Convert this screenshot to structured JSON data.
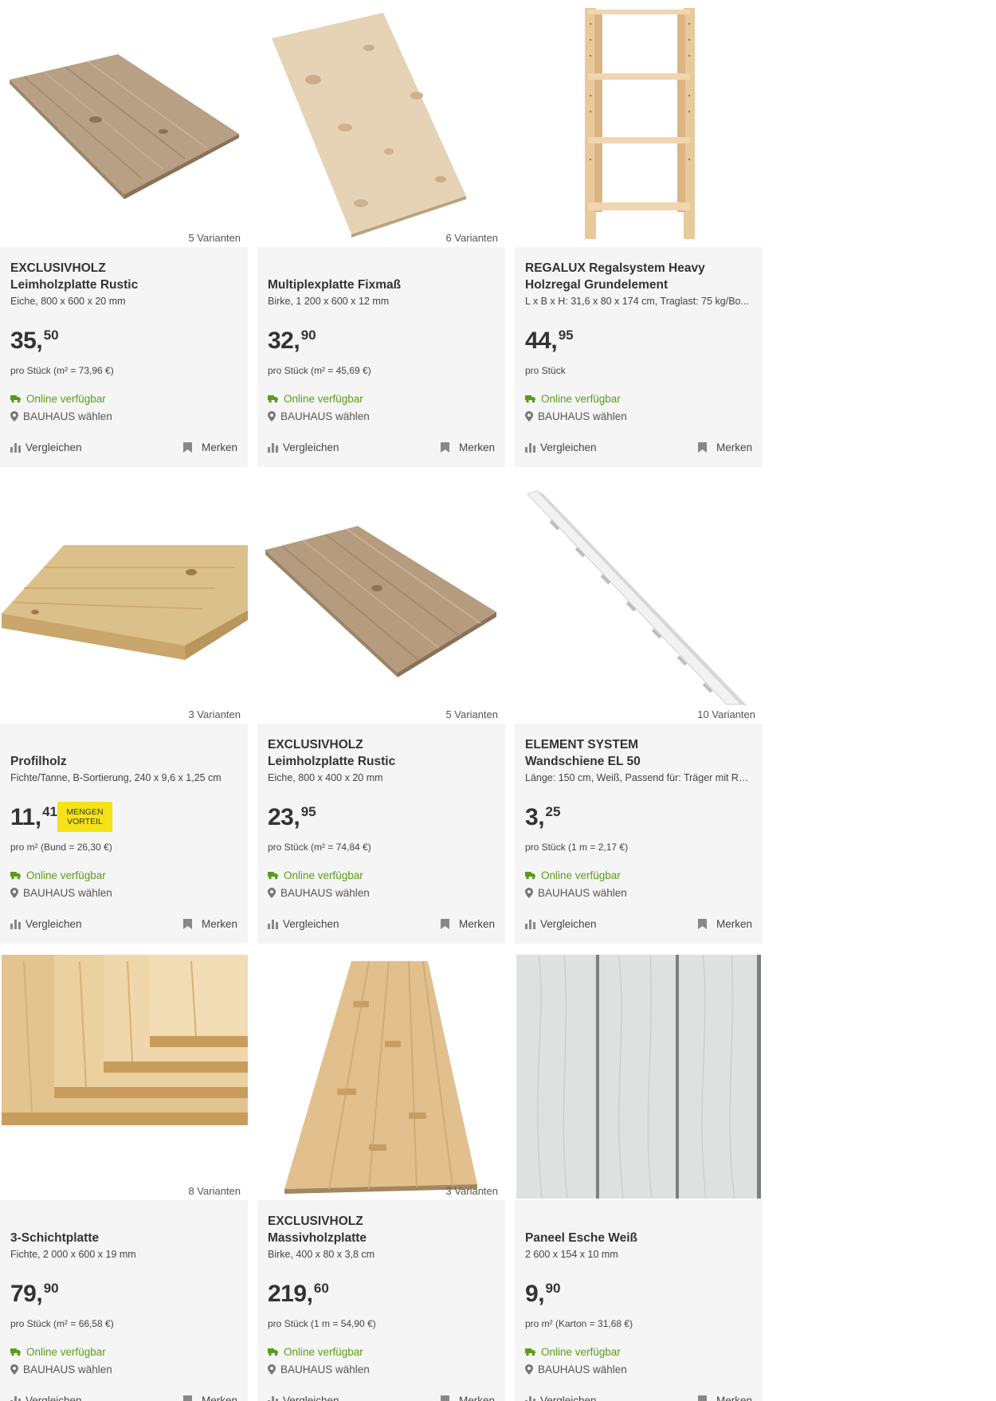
{
  "products": [
    {
      "brand": "EXCLUSIVHOLZ",
      "title": "Leimholzplatte Rustic",
      "description": "Eiche, 800 x 600 x 20 mm",
      "price_int": "35",
      "price_dec": "50",
      "unit_price": "pro Stück (m² = 73,96 €)",
      "variants": "5 Varianten",
      "image": "oak-panel"
    },
    {
      "brand": "",
      "title": "Multiplexplatte Fixmaß",
      "description": "Birke, 1 200 x 600 x 12 mm",
      "price_int": "32",
      "price_dec": "90",
      "unit_price": "pro Stück (m² = 45,69 €)",
      "variants": "6 Varianten",
      "image": "birch-plywood"
    },
    {
      "brand": "REGALUX Regalsystem Heavy",
      "title": "Holzregal Grundelement",
      "description": "L x B x H: 31,6 x 80 x 174 cm, Traglast: 75 kg/Bo...",
      "price_int": "44",
      "price_dec": "95",
      "unit_price": "pro Stück",
      "variants": "",
      "image": "wood-shelf"
    },
    {
      "brand": "",
      "title": "Profilholz",
      "description": "Fichte/Tanne, B-Sortierung, 240 x 9,6 x 1,25 cm",
      "price_int": "11",
      "price_dec": "41",
      "badge_line1": "MENGEN",
      "badge_line2": "VORTEIL",
      "unit_price": "pro m² (Bund = 26,30 €)",
      "variants": "3 Varianten",
      "image": "profile-wood"
    },
    {
      "brand": "EXCLUSIVHOLZ",
      "title": "Leimholzplatte Rustic",
      "description": "Eiche, 800 x 400 x 20 mm",
      "price_int": "23",
      "price_dec": "95",
      "unit_price": "pro Stück (m² = 74,84 €)",
      "variants": "5 Varianten",
      "image": "oak-panel"
    },
    {
      "brand": "ELEMENT SYSTEM",
      "title": "Wandschiene EL 50",
      "description": "Länge: 150 cm, Weiß, Passend für: Träger mit Ra...",
      "price_int": "3",
      "price_dec": "25",
      "unit_price": "pro Stück (1 m = 2,17 €)",
      "variants": "10 Varianten",
      "image": "wall-rail"
    },
    {
      "brand": "",
      "title": "3-Schichtplatte",
      "description": "Fichte, 2 000 x 600 x 19 mm",
      "price_int": "79",
      "price_dec": "90",
      "unit_price": "pro Stück (m² = 66,58 €)",
      "variants": "8 Varianten",
      "image": "three-layer-boards"
    },
    {
      "brand": "EXCLUSIVHOLZ",
      "title": "Massivholzplatte",
      "description": "Birke, 400 x 80 x 3,8 cm",
      "price_int": "219",
      "price_dec": "60",
      "unit_price": "pro Stück (1 m = 54,90 €)",
      "variants": "3 Varianten",
      "image": "solid-wood-board"
    },
    {
      "brand": "",
      "title": "Paneel Esche Weiß",
      "description": "2 600 x 154 x 10 mm",
      "price_int": "9",
      "price_dec": "90",
      "unit_price": "pro m² (Karton = 31,68 €)",
      "variants": "",
      "image": "white-ash-panel"
    }
  ],
  "labels": {
    "online": "Online verfügbar",
    "store": "BAUHAUS wählen",
    "compare": "Vergleichen",
    "save": "Merken",
    "comma": ","
  },
  "colors": {
    "card_bg": "#f5f5f5",
    "available_green": "#5a9c17",
    "badge_yellow": "#f6e317",
    "text": "#333333"
  }
}
